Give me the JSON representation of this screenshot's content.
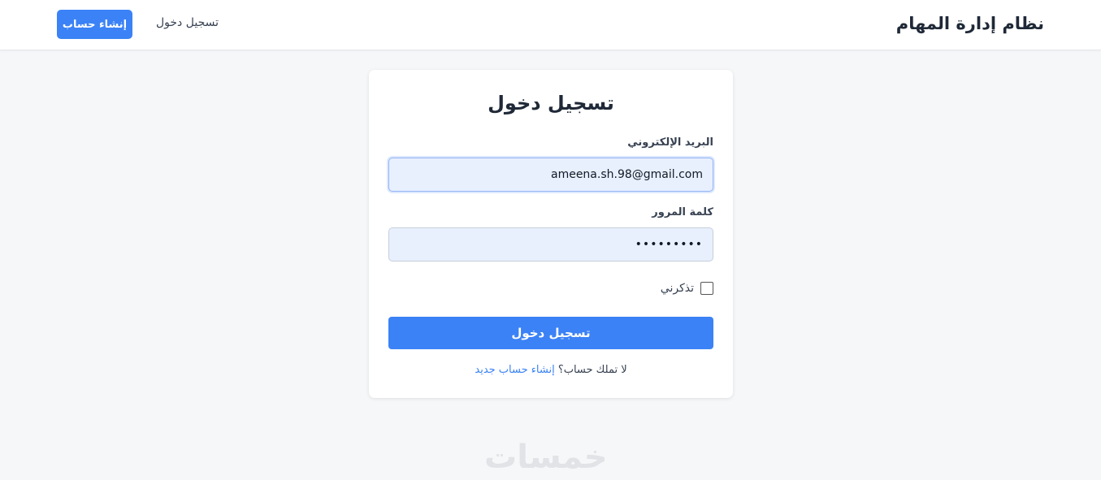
{
  "header": {
    "brand": "نظام إدارة المهام",
    "nav_login": "تسجيل دخول",
    "nav_signup": "إنشاء حساب"
  },
  "form": {
    "title": "تسجيل دخول",
    "email_label": "البريد الإلكتروني",
    "email_value": "ameena.sh.98@gmail.com",
    "password_label": "كلمة المرور",
    "password_value": "•••••••••",
    "remember_label": "تذكرني",
    "remember_checked": false,
    "submit_label": "تسجيل دخول",
    "no_account_text": "لا تملك حساب؟ ",
    "signup_link": "إنشاء حساب جديد"
  },
  "watermark": "خمسات",
  "colors": {
    "accent": "#3b82f6",
    "page_bg": "#f6f7f9",
    "input_bg": "#e8f0fe"
  }
}
